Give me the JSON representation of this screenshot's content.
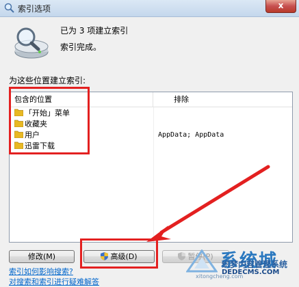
{
  "window": {
    "title": "索引选项",
    "close_label": "x"
  },
  "status": {
    "count_text": "已为 3 项建立索引",
    "state_text": "索引完成。"
  },
  "locations": {
    "section_label": "为这些位置建立索引:",
    "headers": {
      "included": "包含的位置",
      "excluded": "排除"
    },
    "rows": [
      {
        "name": "「开始」菜单",
        "excluded": ""
      },
      {
        "name": "收藏夹",
        "excluded": ""
      },
      {
        "name": "用户",
        "excluded": "AppData; AppData"
      },
      {
        "name": "迅雷下载",
        "excluded": ""
      }
    ]
  },
  "buttons": {
    "modify": "修改(M)",
    "advanced": "高级(D)",
    "pause": "暂停(P)"
  },
  "links": {
    "impact": "索引如何影响搜索?",
    "troubleshoot": "对搜索和索引进行疑难解答"
  },
  "watermark": {
    "brand": "系统城",
    "line1": "织梦内容管理系统",
    "line2": "DEDECMS.COM",
    "url": "xitongcheng.com"
  },
  "colors": {
    "annotation": "#e32020",
    "link": "#0066cc",
    "folder": "#e8b923"
  }
}
